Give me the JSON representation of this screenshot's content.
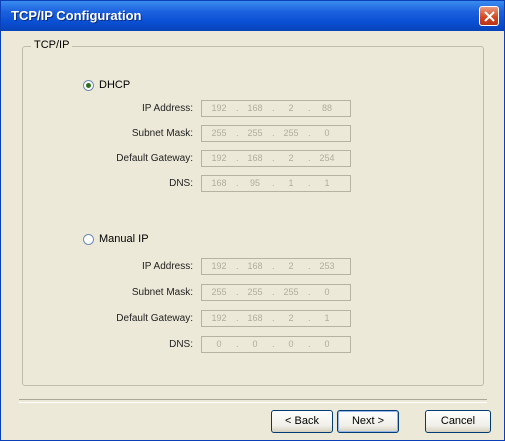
{
  "window": {
    "title": "TCP/IP Configuration"
  },
  "group": {
    "legend": "TCP/IP"
  },
  "dhcp": {
    "label": "DHCP",
    "selected": true,
    "fields": [
      {
        "label": "IP Address:",
        "octets": [
          "192",
          "168",
          "2",
          "88"
        ]
      },
      {
        "label": "Subnet Mask:",
        "octets": [
          "255",
          "255",
          "255",
          "0"
        ]
      },
      {
        "label": "Default Gateway:",
        "octets": [
          "192",
          "168",
          "2",
          "254"
        ]
      },
      {
        "label": "DNS:",
        "octets": [
          "168",
          "95",
          "1",
          "1"
        ]
      }
    ]
  },
  "manual": {
    "label": "Manual IP",
    "selected": false,
    "fields": [
      {
        "label": "IP Address:",
        "octets": [
          "192",
          "168",
          "2",
          "253"
        ]
      },
      {
        "label": "Subnet Mask:",
        "octets": [
          "255",
          "255",
          "255",
          "0"
        ]
      },
      {
        "label": "Default Gateway:",
        "octets": [
          "192",
          "168",
          "2",
          "1"
        ]
      },
      {
        "label": "DNS:",
        "octets": [
          "0",
          "0",
          "0",
          "0"
        ]
      }
    ]
  },
  "buttons": {
    "back": "< Back",
    "next": "Next >",
    "cancel": "Cancel"
  },
  "colors": {
    "titlebar": "#0a4fd4",
    "dialog_bg": "#ece9d8",
    "close_button": "#d2441d"
  },
  "icons": {
    "close": "close-icon"
  }
}
